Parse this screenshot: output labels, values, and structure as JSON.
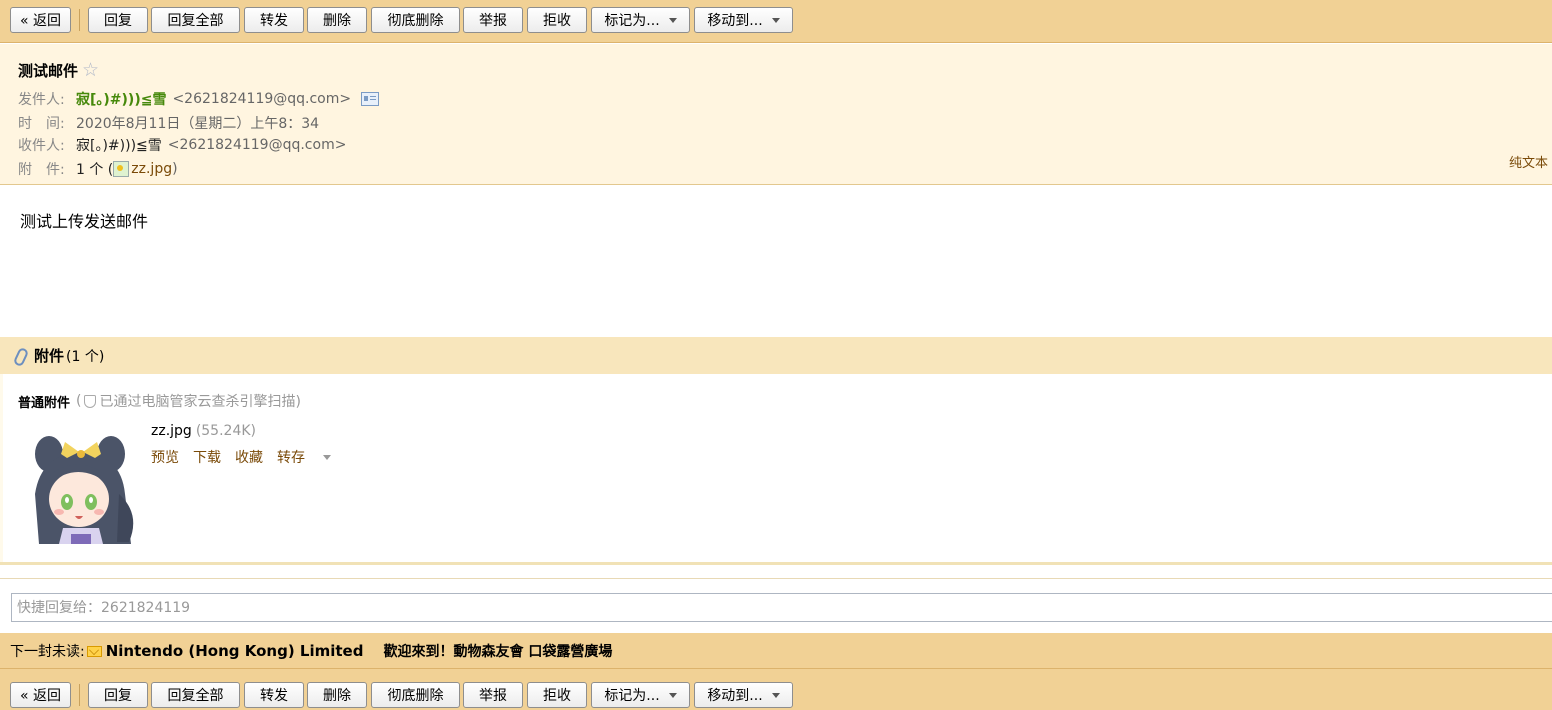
{
  "toolbar": {
    "back": "« 返回",
    "reply": "回复",
    "reply_all": "回复全部",
    "forward": "转发",
    "delete": "删除",
    "delete_permanently": "彻底删除",
    "report": "举报",
    "reject": "拒收",
    "mark_as": "标记为...",
    "move_to": "移动到..."
  },
  "mail": {
    "subject": "测试邮件",
    "star_icon": "☆",
    "from_label": "发件人:",
    "from_name": "寂[。)#)))≦雪",
    "from_address": "<2621824119@qq.com>",
    "time_label": "时　间:",
    "time_value": "2020年8月11日（星期二）上午8：34",
    "to_label": "收件人:",
    "to_name": "寂[。)#)))≦雪",
    "to_address": "<2621824119@qq.com>",
    "attach_label": "附　件:",
    "attach_count": "1 个 (",
    "attach_file": "zz.jpg",
    "attach_close": ")",
    "plain_text": "纯文本",
    "body": "测试上传发送邮件"
  },
  "attachments": {
    "title": "附件",
    "count": "(1 个)",
    "normal_label": "普通附件",
    "scan_note_open": "(",
    "scan_note": "已通过电脑管家云查杀引擎扫描)",
    "file_name": "zz.jpg",
    "file_size": "(55.24K)",
    "actions": {
      "preview": "预览",
      "download": "下载",
      "favorite": "收藏",
      "save_to": "转存"
    }
  },
  "quick_reply": {
    "placeholder": "快捷回复给：2621824119"
  },
  "next_unread": {
    "label": "下一封未读:",
    "sender": "Nintendo (Hong Kong) Limited",
    "subject": "歡迎來到！動物森友會 口袋露營廣場"
  },
  "colors": {
    "toolbar_bg": "#f1d195",
    "header_bg": "#fff5e0",
    "sender_green": "#46890b",
    "link_brown": "#7a4a08"
  }
}
